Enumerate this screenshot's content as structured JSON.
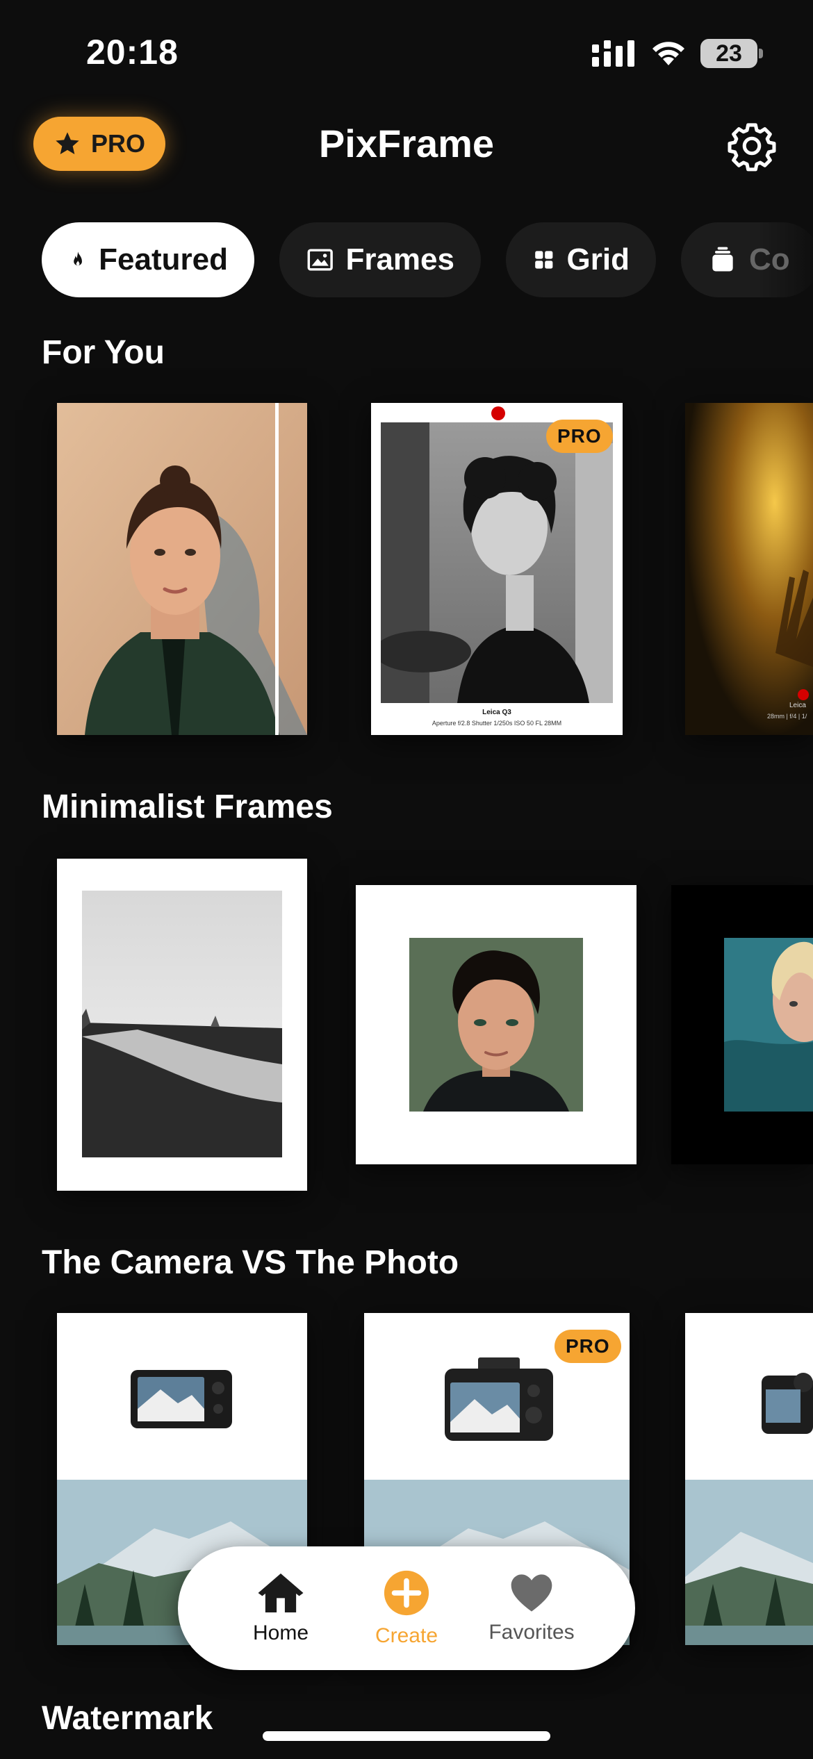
{
  "status": {
    "time": "20:18",
    "battery": "23"
  },
  "header": {
    "pro_label": "PRO",
    "title": "PixFrame"
  },
  "tabs": [
    {
      "label": "Featured",
      "icon": "flame-icon",
      "active": true
    },
    {
      "label": "Frames",
      "icon": "image-icon"
    },
    {
      "label": "Grid",
      "icon": "grid-icon"
    },
    {
      "label": "Co",
      "icon": "stack-icon"
    }
  ],
  "sections": {
    "for_you": "For You",
    "minimalist": "Minimalist Frames",
    "camera_vs": "The Camera VS The Photo",
    "watermark": "Watermark"
  },
  "for_you_cards": {
    "card2": {
      "badge": "PRO",
      "camera": "Leica Q3",
      "exif": "Aperture f/2.8   Shutter 1/250s   ISO 50   FL 28MM"
    },
    "card3": {
      "camera": "Leica",
      "exif": "28mm | f/4 | 1/"
    }
  },
  "camera_cards": {
    "card2_badge": "PRO"
  },
  "nav": {
    "home": "Home",
    "create": "Create",
    "favorites": "Favorites"
  },
  "colors": {
    "accent": "#f6a532",
    "background": "#0d0d0d"
  }
}
